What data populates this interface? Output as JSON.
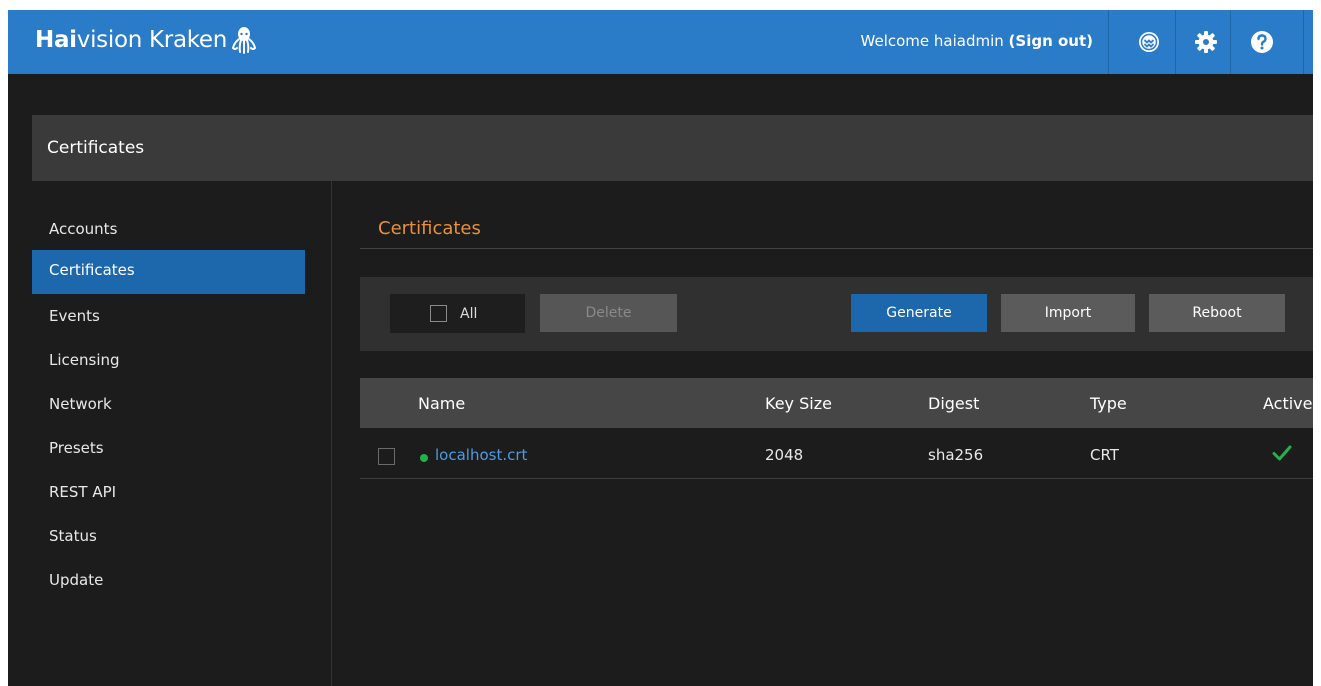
{
  "header": {
    "brand_bold": "Hai",
    "brand_rest": "vision Kraken",
    "welcome_text": "Welcome haiadmin",
    "signout_label": "(Sign out)"
  },
  "page_title": "Certificates",
  "sidebar": {
    "items": [
      {
        "label": "Accounts"
      },
      {
        "label": "Certificates"
      },
      {
        "label": "Events"
      },
      {
        "label": "Licensing"
      },
      {
        "label": "Network"
      },
      {
        "label": "Presets"
      },
      {
        "label": "REST API"
      },
      {
        "label": "Status"
      },
      {
        "label": "Update"
      }
    ],
    "active_index": 1
  },
  "section": {
    "title": "Certificates"
  },
  "toolbar": {
    "all_label": "All",
    "delete_label": "Delete",
    "generate_label": "Generate",
    "import_label": "Import",
    "reboot_label": "Reboot"
  },
  "table": {
    "columns": [
      "Name",
      "Key Size",
      "Digest",
      "Type",
      "Active"
    ],
    "rows": [
      {
        "name": "localhost.crt",
        "key_size": "2048",
        "digest": "sha256",
        "type": "CRT",
        "active": true
      }
    ]
  },
  "colors": {
    "header_blue": "#2a7bc8",
    "accent_orange": "#e8913a",
    "active_blue": "#1d67ad",
    "status_green": "#22b14c"
  }
}
